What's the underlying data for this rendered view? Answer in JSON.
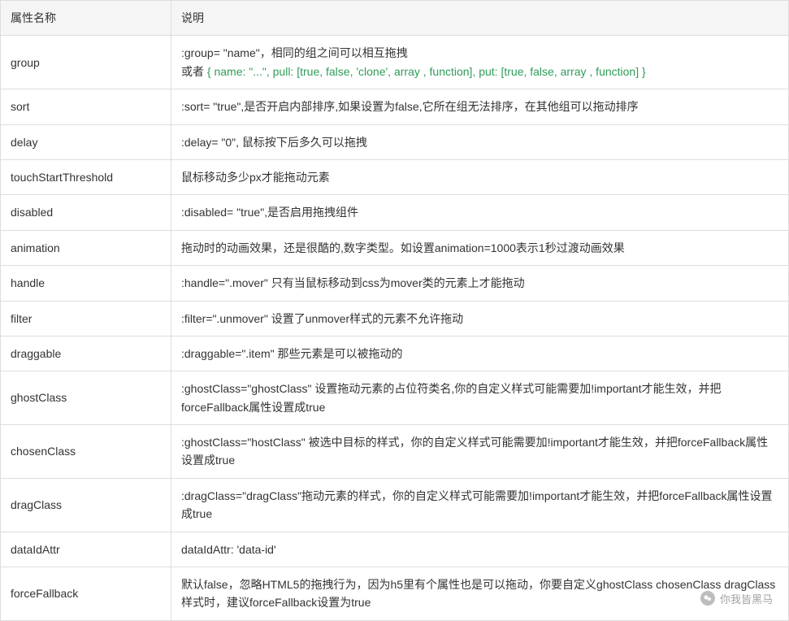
{
  "table": {
    "headers": [
      "属性名称",
      "说明"
    ],
    "rows": [
      {
        "name": "group",
        "desc_prefix": ":group= \"name\"，相同的组之间可以相互拖拽",
        "desc_or": "或者 ",
        "desc_code": "{ name: \"...\", pull: [true, false, 'clone', array , function], put: [true, false, array , function] }"
      },
      {
        "name": "sort",
        "desc": ":sort= \"true\",是否开启内部排序,如果设置为false,它所在组无法排序，在其他组可以拖动排序"
      },
      {
        "name": "delay",
        "desc": ":delay= \"0\", 鼠标按下后多久可以拖拽"
      },
      {
        "name": "touchStartThreshold",
        "desc": "鼠标移动多少px才能拖动元素"
      },
      {
        "name": "disabled",
        "desc": ":disabled= \"true\",是否启用拖拽组件"
      },
      {
        "name": "animation",
        "desc": "拖动时的动画效果，还是很酷的,数字类型。如设置animation=1000表示1秒过渡动画效果"
      },
      {
        "name": "handle",
        "desc": ":handle=\".mover\" 只有当鼠标移动到css为mover类的元素上才能拖动"
      },
      {
        "name": "filter",
        "desc": ":filter=\".unmover\" 设置了unmover样式的元素不允许拖动"
      },
      {
        "name": "draggable",
        "desc": ":draggable=\".item\" 那些元素是可以被拖动的"
      },
      {
        "name": "ghostClass",
        "desc": ":ghostClass=\"ghostClass\" 设置拖动元素的占位符类名,你的自定义样式可能需要加!important才能生效，并把forceFallback属性设置成true"
      },
      {
        "name": "chosenClass",
        "desc": ":ghostClass=\"hostClass\" 被选中目标的样式，你的自定义样式可能需要加!important才能生效，并把forceFallback属性设置成true"
      },
      {
        "name": "dragClass",
        "desc": ":dragClass=\"dragClass\"拖动元素的样式，你的自定义样式可能需要加!important才能生效，并把forceFallback属性设置成true"
      },
      {
        "name": "dataIdAttr",
        "desc": "dataIdAttr: 'data-id'"
      },
      {
        "name": "forceFallback",
        "desc": "默认false，忽略HTML5的拖拽行为，因为h5里有个属性也是可以拖动，你要自定义ghostClass chosenClass dragClass样式时，建议forceFallback设置为true"
      }
    ]
  },
  "watermark": {
    "text": "你我皆黑马"
  }
}
